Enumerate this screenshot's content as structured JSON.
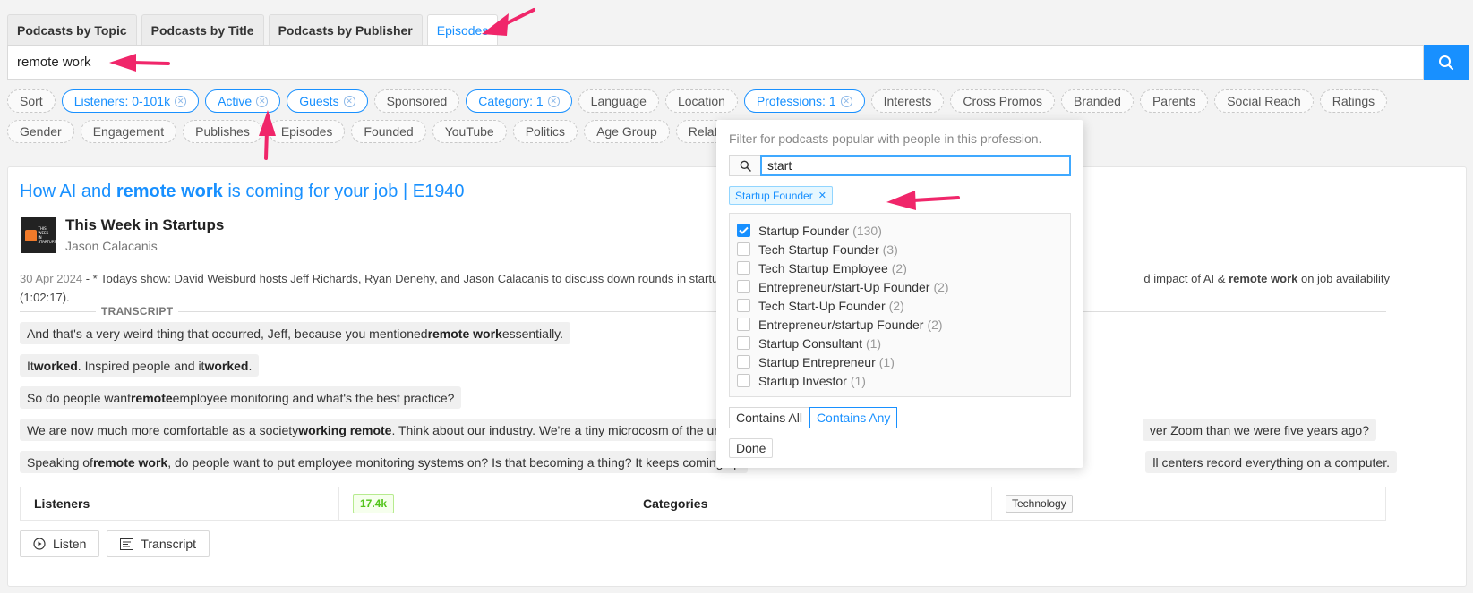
{
  "tabs": [
    {
      "label": "Podcasts by Topic"
    },
    {
      "label": "Podcasts by Title"
    },
    {
      "label": "Podcasts by Publisher"
    },
    {
      "label": "Episodes"
    }
  ],
  "search": {
    "value": "remote work",
    "icon": "search-icon"
  },
  "filters": [
    {
      "label": "Sort",
      "active": false
    },
    {
      "label": "Listeners: 0-101k",
      "active": true
    },
    {
      "label": "Active",
      "active": true
    },
    {
      "label": "Guests",
      "active": true
    },
    {
      "label": "Sponsored",
      "active": false
    },
    {
      "label": "Category: 1",
      "active": true
    },
    {
      "label": "Language",
      "active": false
    },
    {
      "label": "Location",
      "active": false
    },
    {
      "label": "Professions: 1",
      "active": true
    },
    {
      "label": "Interests",
      "active": false
    },
    {
      "label": "Cross Promos",
      "active": false
    },
    {
      "label": "Branded",
      "active": false
    },
    {
      "label": "Parents",
      "active": false
    },
    {
      "label": "Social Reach",
      "active": false
    },
    {
      "label": "Ratings",
      "active": false
    },
    {
      "label": "Gender",
      "active": false
    },
    {
      "label": "Engagement",
      "active": false
    },
    {
      "label": "Publishes",
      "active": false
    },
    {
      "label": "Episodes",
      "active": false
    },
    {
      "label": "Founded",
      "active": false
    },
    {
      "label": "YouTube",
      "active": false
    },
    {
      "label": "Politics",
      "active": false
    },
    {
      "label": "Age Group",
      "active": false
    },
    {
      "label": "Relationships",
      "active": false
    }
  ],
  "episode": {
    "title_pre": "How AI and ",
    "title_bold": "remote work",
    "title_post": " is coming for your job | E1940",
    "podcast_name": "This Week in Startups",
    "host": "Jason Calacanis",
    "logo_text": "THIS WEEK IN STARTUPS",
    "date": "30 Apr 2024",
    "desc_left": " - * Todays show: David Weisburd hosts Jeff Richards, Ryan Denehy, and Jason Calacanis to discuss down rounds in startu",
    "desc_right_pre": "d impact of AI & ",
    "desc_right_bold": "remote work",
    "desc_right_post": " on job availability",
    "desc_line2": "(1:02:17).",
    "transcript_label": "TRANSCRIPT",
    "snippets": [
      {
        "parts": [
          {
            "t": "And that's a very weird thing that occurred, Jeff, because you mentioned ",
            "b": false
          },
          {
            "t": "remote work",
            "b": true
          },
          {
            "t": " essentially.",
            "b": false
          }
        ]
      },
      {
        "parts": [
          {
            "t": "It ",
            "b": false
          },
          {
            "t": "worked",
            "b": true
          },
          {
            "t": ". Inspired people and it ",
            "b": false
          },
          {
            "t": "worked",
            "b": true
          },
          {
            "t": ".",
            "b": false
          }
        ]
      },
      {
        "parts": [
          {
            "t": "So do people want ",
            "b": false
          },
          {
            "t": "remote",
            "b": true
          },
          {
            "t": " employee monitoring and what's the best practice?",
            "b": false
          }
        ]
      },
      {
        "parts": [
          {
            "t": "We are now much more comfortable as a society ",
            "b": false
          },
          {
            "t": "working remote",
            "b": true
          },
          {
            "t": ". Think about our industry. We're a tiny microcosm of the univers",
            "b": false
          }
        ],
        "tail": "ver Zoom than we were five years ago?"
      },
      {
        "parts": [
          {
            "t": "Speaking of ",
            "b": false
          },
          {
            "t": "remote work",
            "b": true
          },
          {
            "t": ", do people want to put employee monitoring systems on? Is that becoming a thing? It keeps coming up",
            "b": false
          }
        ],
        "tail": "ll centers record everything on a computer."
      }
    ],
    "stats": {
      "listeners_label": "Listeners",
      "listeners_value": "17.4k",
      "categories_label": "Categories",
      "category_tag": "Technology"
    },
    "actions": {
      "listen": "Listen",
      "transcript": "Transcript"
    }
  },
  "profession_popover": {
    "help": "Filter for podcasts popular with people in this profession.",
    "search_value": "start",
    "selected_tag": "Startup Founder",
    "options": [
      {
        "label": "Startup Founder",
        "count": "(130)",
        "checked": true
      },
      {
        "label": "Tech Startup Founder",
        "count": "(3)",
        "checked": false
      },
      {
        "label": "Tech Startup Employee",
        "count": "(2)",
        "checked": false
      },
      {
        "label": "Entrepreneur/start-Up Founder",
        "count": "(2)",
        "checked": false
      },
      {
        "label": "Tech Start-Up Founder",
        "count": "(2)",
        "checked": false
      },
      {
        "label": "Entrepreneur/startup Founder",
        "count": "(2)",
        "checked": false
      },
      {
        "label": "Startup Consultant",
        "count": "(1)",
        "checked": false
      },
      {
        "label": "Startup Entrepreneur",
        "count": "(1)",
        "checked": false
      },
      {
        "label": "Startup Investor",
        "count": "(1)",
        "checked": false
      }
    ],
    "mode_all": "Contains All",
    "mode_any": "Contains Any",
    "mode_selected": "Contains Any",
    "done": "Done"
  },
  "colors": {
    "accent": "#1890ff",
    "annotation": "#f0266a",
    "listeners_badge": "#52c41a"
  }
}
